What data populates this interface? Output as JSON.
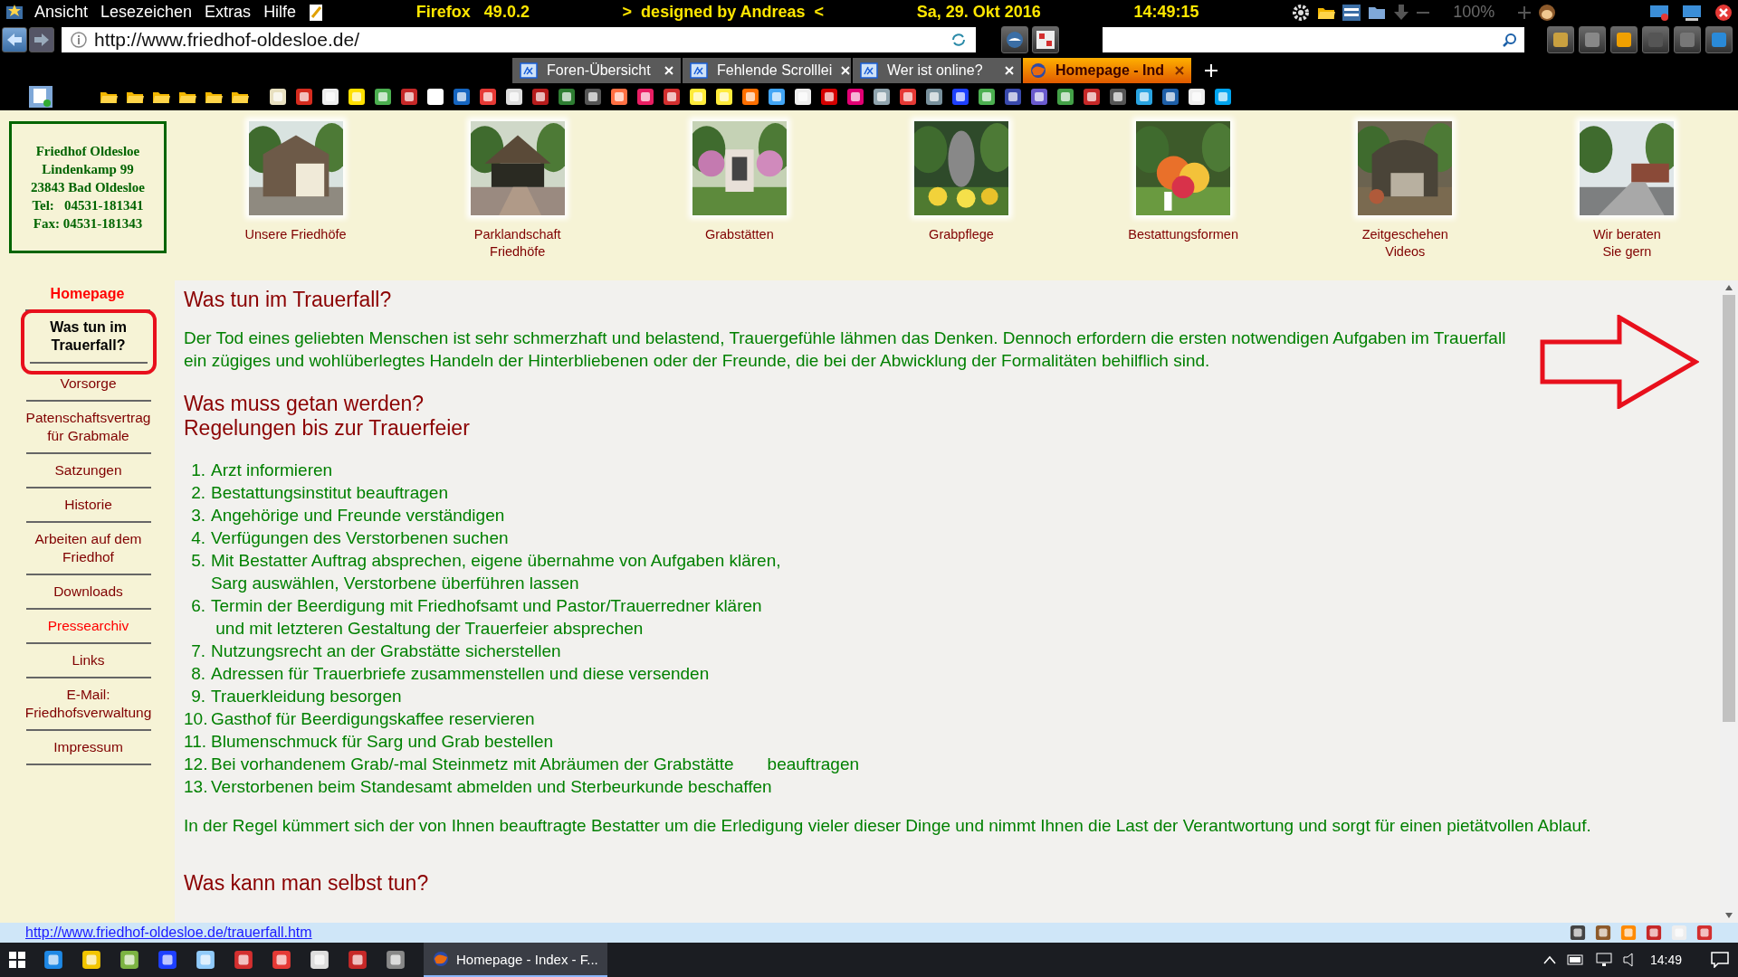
{
  "menu_bar": {
    "items": [
      "Ansicht",
      "Lesezeichen",
      "Extras",
      "Hilfe"
    ],
    "browser_info": "Firefox   49.0.2",
    "designer": ">  designed by Andreas  <",
    "date": "Sa, 29. Okt 2016",
    "time": "14:49:15",
    "zoom": "100%"
  },
  "address_bar": {
    "url": "http://www.friedhof-oldesloe.de/"
  },
  "tabs": [
    {
      "label": "Foren-Übersicht",
      "selected": false
    },
    {
      "label": "Fehlende Scrolllei",
      "selected": false
    },
    {
      "label": "Wer ist online?",
      "selected": false
    },
    {
      "label": "Homepage - Ind",
      "selected": true
    }
  ],
  "address_card": {
    "lines": [
      "Friedhof Oldesloe",
      "Lindenkamp 99",
      "23843 Bad Oldesloe",
      "Tel:   04531-181341",
      "Fax: 04531-181343"
    ]
  },
  "gallery": [
    {
      "caption": [
        "Unsere Friedhöfe"
      ],
      "kind": "picture"
    },
    {
      "caption": [
        "Parklandschaft",
        "Friedhöfe"
      ],
      "kind": "picture"
    },
    {
      "caption": [
        "Grabstätten"
      ],
      "kind": "picture"
    },
    {
      "caption": [
        "Grabpflege"
      ],
      "kind": "picture"
    },
    {
      "caption": [
        "Bestattungsformen"
      ],
      "kind": "picture"
    },
    {
      "caption": [
        "Zeitgeschehen",
        "Videos"
      ],
      "kind": "picture"
    },
    {
      "caption": [
        "Wir beraten",
        "Sie gern"
      ],
      "kind": "picture"
    }
  ],
  "sidebar": {
    "items": [
      {
        "label": "Homepage",
        "kind": "heading",
        "selected": false,
        "color": "#ff0000"
      },
      {
        "label": "Was tun im Trauerfall?",
        "kind": "link",
        "selected": true,
        "color": "#000000"
      },
      {
        "label": "Vorsorge",
        "kind": "link",
        "selected": false,
        "color": "#800000"
      },
      {
        "label": "Patenschaftsvertrag für Grabmale",
        "kind": "link",
        "selected": false,
        "color": "#800000"
      },
      {
        "label": "Satzungen",
        "kind": "link",
        "selected": false,
        "color": "#800000"
      },
      {
        "label": "Historie",
        "kind": "link",
        "selected": false,
        "color": "#800000"
      },
      {
        "label": "Arbeiten auf dem Friedhof",
        "kind": "link",
        "selected": false,
        "color": "#800000"
      },
      {
        "label": "Downloads",
        "kind": "link",
        "selected": false,
        "color": "#800000"
      },
      {
        "label": "Pressearchiv",
        "kind": "link",
        "selected": false,
        "color": "#ff0000"
      },
      {
        "label": "Links",
        "kind": "link",
        "selected": false,
        "color": "#800000"
      },
      {
        "label": "E-Mail: Friedhofsverwaltung",
        "kind": "link",
        "selected": false,
        "color": "#800000"
      },
      {
        "label": "Impressum",
        "kind": "link",
        "selected": false,
        "color": "#800000"
      }
    ]
  },
  "content": {
    "title": "Was tun im Trauerfall?",
    "intro": "Der Tod eines geliebten Menschen ist sehr schmerzhaft und belastend, Trauergefühle lähmen das Denken. Dennoch erfordern die ersten notwendigen Aufgaben im Trauerfall ein zügiges und wohlüberlegtes Handeln der Hinterbliebenen oder der Freunde, die bei der Abwicklung der Formalitäten behilflich sind.",
    "section_heading": [
      "Was muss getan werden?",
      "Regelungen bis zur Trauerfeier"
    ],
    "steps": [
      {
        "number": "1.",
        "lines": [
          "Arzt informieren"
        ]
      },
      {
        "number": "2.",
        "lines": [
          "Bestattungsinstitut beauftragen"
        ]
      },
      {
        "number": "3.",
        "lines": [
          "Angehörige und Freunde verständigen"
        ]
      },
      {
        "number": "4.",
        "lines": [
          "Verfügungen des Verstorbenen suchen"
        ]
      },
      {
        "number": "5.",
        "lines": [
          "Mit Bestatter Auftrag absprechen, eigene übernahme von Aufgaben klären,",
          "Sarg auswählen, Verstorbene überführen lassen"
        ]
      },
      {
        "number": "6.",
        "lines": [
          "Termin der Beerdigung mit Friedhofsamt und Pastor/Trauerredner klären",
          " und mit letzteren Gestaltung der Trauerfeier absprechen"
        ]
      },
      {
        "number": "7.",
        "lines": [
          "Nutzungsrecht an der Grabstätte sicherstellen"
        ]
      },
      {
        "number": "8.",
        "lines": [
          "Adressen für Trauerbriefe zusammenstellen und diese versenden"
        ]
      },
      {
        "number": "9.",
        "lines": [
          "Trauerkleidung besorgen"
        ]
      },
      {
        "number": "10.",
        "lines": [
          "Gasthof für Beerdigungskaffee reservieren"
        ]
      },
      {
        "number": "11.",
        "lines": [
          "Blumenschmuck für Sarg und Grab bestellen"
        ]
      },
      {
        "number": "12.",
        "lines": [
          "Bei vorhandenem Grab/-mal Steinmetz mit Abräumen der Grabstätte       beauftragen"
        ]
      },
      {
        "number": "13.",
        "lines": [
          "Verstorbenen beim Standesamt abmelden und Sterbeurkunde beschaffen"
        ]
      }
    ],
    "closing": "In der Regel kümmert sich der von Ihnen beauftragte Bestatter um die Erledigung vieler dieser Dinge und nimmt Ihnen die Last der Verantwortung und sorgt für einen pietätvollen Ablauf.",
    "next_heading": "Was kann man selbst tun?"
  },
  "status_bar": {
    "link": "http://www.friedhof-oldesloe.de/trauerfall.htm"
  },
  "taskbar": {
    "window": "Homepage - Index - F...",
    "clock": "14:49"
  }
}
